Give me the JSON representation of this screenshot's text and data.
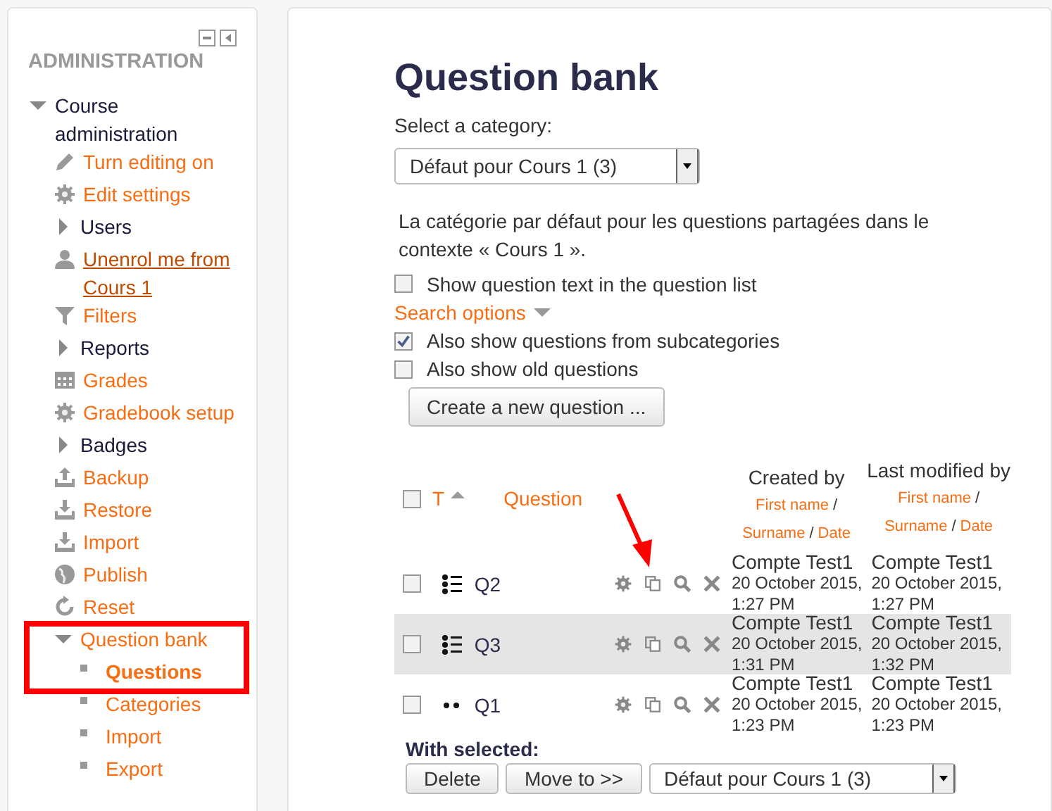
{
  "sidebar": {
    "title": "ADMINISTRATION",
    "items": [
      {
        "label": "Course administration",
        "kind": "branch",
        "expanded": true,
        "children": [
          {
            "label": "Turn editing on",
            "kind": "link"
          },
          {
            "label": "Edit settings",
            "kind": "link"
          },
          {
            "label": "Users",
            "kind": "branch",
            "expanded": false
          },
          {
            "label": "Unenrol me from Cours 1",
            "kind": "link",
            "hovered": true
          },
          {
            "label": "Filters",
            "kind": "link"
          },
          {
            "label": "Reports",
            "kind": "branch",
            "expanded": false
          },
          {
            "label": "Grades",
            "kind": "link"
          },
          {
            "label": "Gradebook setup",
            "kind": "link"
          },
          {
            "label": "Badges",
            "kind": "branch",
            "expanded": false
          },
          {
            "label": "Backup",
            "kind": "link"
          },
          {
            "label": "Restore",
            "kind": "link"
          },
          {
            "label": "Import",
            "kind": "link"
          },
          {
            "label": "Publish",
            "kind": "link"
          },
          {
            "label": "Reset",
            "kind": "link"
          },
          {
            "label": "Question bank",
            "kind": "branch",
            "expanded": true,
            "highlighted": true,
            "children": [
              {
                "label": "Questions",
                "current": true
              },
              {
                "label": "Categories",
                "current": false
              },
              {
                "label": "Import",
                "current": false
              },
              {
                "label": "Export",
                "current": false
              }
            ]
          }
        ]
      }
    ]
  },
  "main": {
    "title": "Question bank",
    "category_label": "Select a category:",
    "category": "Défaut pour Cours 1 (3)",
    "description": "La catégorie par défaut pour les questions partagées dans le contexte « Cours 1 ».",
    "show_text": {
      "label": "Show question text in the question list",
      "checked": false
    },
    "search_options": "Search options",
    "options": [
      {
        "label": "Also show questions from subcategories",
        "checked": true
      },
      {
        "label": "Also show old questions",
        "checked": false
      }
    ],
    "create_button": "Create a new question ...",
    "table": {
      "columns": {
        "select_all_checked": false,
        "type": "T",
        "question": "Question",
        "created": "Created by",
        "modified": "Last modified by",
        "created_sort": [
          {
            "kind": "link",
            "text": "First name"
          },
          {
            "kind": "sep",
            "text": "/"
          },
          {
            "kind": "link",
            "text": "Surname"
          },
          {
            "kind": "sep",
            "text": "/"
          },
          {
            "kind": "link",
            "text": "Date"
          }
        ],
        "modified_sort": [
          {
            "kind": "link",
            "text": "First name"
          },
          {
            "kind": "sep",
            "text": "/"
          },
          {
            "kind": "link",
            "text": "Surname"
          },
          {
            "kind": "sep",
            "text": "/"
          },
          {
            "kind": "link",
            "text": "Date"
          }
        ]
      },
      "rows": [
        {
          "checked": false,
          "kind": "multichoice",
          "name": "Q2",
          "created_by": "Compte Test1",
          "created_date": "20 October 2015, 1:27 PM",
          "modified_by": "Compte Test1",
          "modified_date": "20 October 2015, 1:27 PM"
        },
        {
          "checked": false,
          "kind": "multichoice",
          "name": "Q3",
          "created_by": "Compte Test1",
          "created_date": "20 October 2015, 1:31 PM",
          "modified_by": "Compte Test1",
          "modified_date": "20 October 2015, 1:32 PM"
        },
        {
          "checked": false,
          "kind": "truefalse",
          "name": "Q1",
          "created_by": "Compte Test1",
          "created_date": "20 October 2015, 1:23 PM",
          "modified_by": "Compte Test1",
          "modified_date": "20 October 2015, 1:23 PM"
        }
      ]
    },
    "with_selected": "With selected:",
    "bulk_buttons": [
      "Delete",
      "Move to >>"
    ],
    "move_target": "Défaut pour Cours 1 (3)"
  }
}
